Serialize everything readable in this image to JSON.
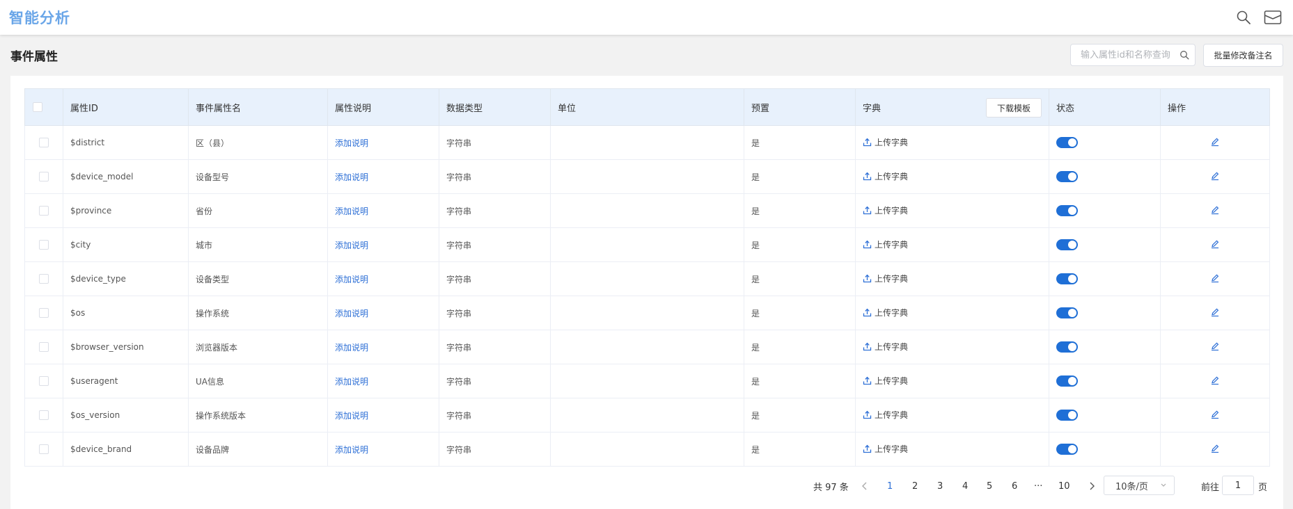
{
  "app": {
    "title": "智能分析"
  },
  "page": {
    "title": "事件属性"
  },
  "search": {
    "placeholder": "输入属性id和名称查询",
    "value": ""
  },
  "toolbar": {
    "batch_label": "批量修改备注名"
  },
  "table": {
    "headers": {
      "id": "属性ID",
      "name": "事件属性名",
      "desc": "属性说明",
      "type": "数据类型",
      "unit": "单位",
      "preset": "预置",
      "dict": "字典",
      "dict_download": "下载模板",
      "status": "状态",
      "ops": "操作"
    },
    "rows": [
      {
        "id": "$district",
        "name": "区（县）",
        "desc": "添加说明",
        "type": "字符串",
        "unit": "",
        "preset": "是",
        "dict": "上传字典",
        "enabled": true
      },
      {
        "id": "$device_model",
        "name": "设备型号",
        "desc": "添加说明",
        "type": "字符串",
        "unit": "",
        "preset": "是",
        "dict": "上传字典",
        "enabled": true
      },
      {
        "id": "$province",
        "name": "省份",
        "desc": "添加说明",
        "type": "字符串",
        "unit": "",
        "preset": "是",
        "dict": "上传字典",
        "enabled": true
      },
      {
        "id": "$city",
        "name": "城市",
        "desc": "添加说明",
        "type": "字符串",
        "unit": "",
        "preset": "是",
        "dict": "上传字典",
        "enabled": true
      },
      {
        "id": "$device_type",
        "name": "设备类型",
        "desc": "添加说明",
        "type": "字符串",
        "unit": "",
        "preset": "是",
        "dict": "上传字典",
        "enabled": true
      },
      {
        "id": "$os",
        "name": "操作系统",
        "desc": "添加说明",
        "type": "字符串",
        "unit": "",
        "preset": "是",
        "dict": "上传字典",
        "enabled": true
      },
      {
        "id": "$browser_version",
        "name": "浏览器版本",
        "desc": "添加说明",
        "type": "字符串",
        "unit": "",
        "preset": "是",
        "dict": "上传字典",
        "enabled": true
      },
      {
        "id": "$useragent",
        "name": "UA信息",
        "desc": "添加说明",
        "type": "字符串",
        "unit": "",
        "preset": "是",
        "dict": "上传字典",
        "enabled": true
      },
      {
        "id": "$os_version",
        "name": "操作系统版本",
        "desc": "添加说明",
        "type": "字符串",
        "unit": "",
        "preset": "是",
        "dict": "上传字典",
        "enabled": true
      },
      {
        "id": "$device_brand",
        "name": "设备品牌",
        "desc": "添加说明",
        "type": "字符串",
        "unit": "",
        "preset": "是",
        "dict": "上传字典",
        "enabled": true
      }
    ]
  },
  "pagination": {
    "total_label": "共 97 条",
    "pages": [
      "1",
      "2",
      "3",
      "4",
      "5",
      "6",
      "···",
      "10"
    ],
    "current": "1",
    "page_size": "10条/页",
    "jump_prefix": "前往",
    "jump_value": "1",
    "jump_suffix": "页"
  },
  "colors": {
    "accent": "#2d6fd6",
    "toggle_on": "#1f6fd6",
    "header_bg": "#e8f1fc",
    "logo": "#6aa6e8"
  },
  "icons": {
    "search": "search-icon",
    "mail": "mail-icon",
    "upload": "upload-icon",
    "edit": "edit-icon"
  }
}
